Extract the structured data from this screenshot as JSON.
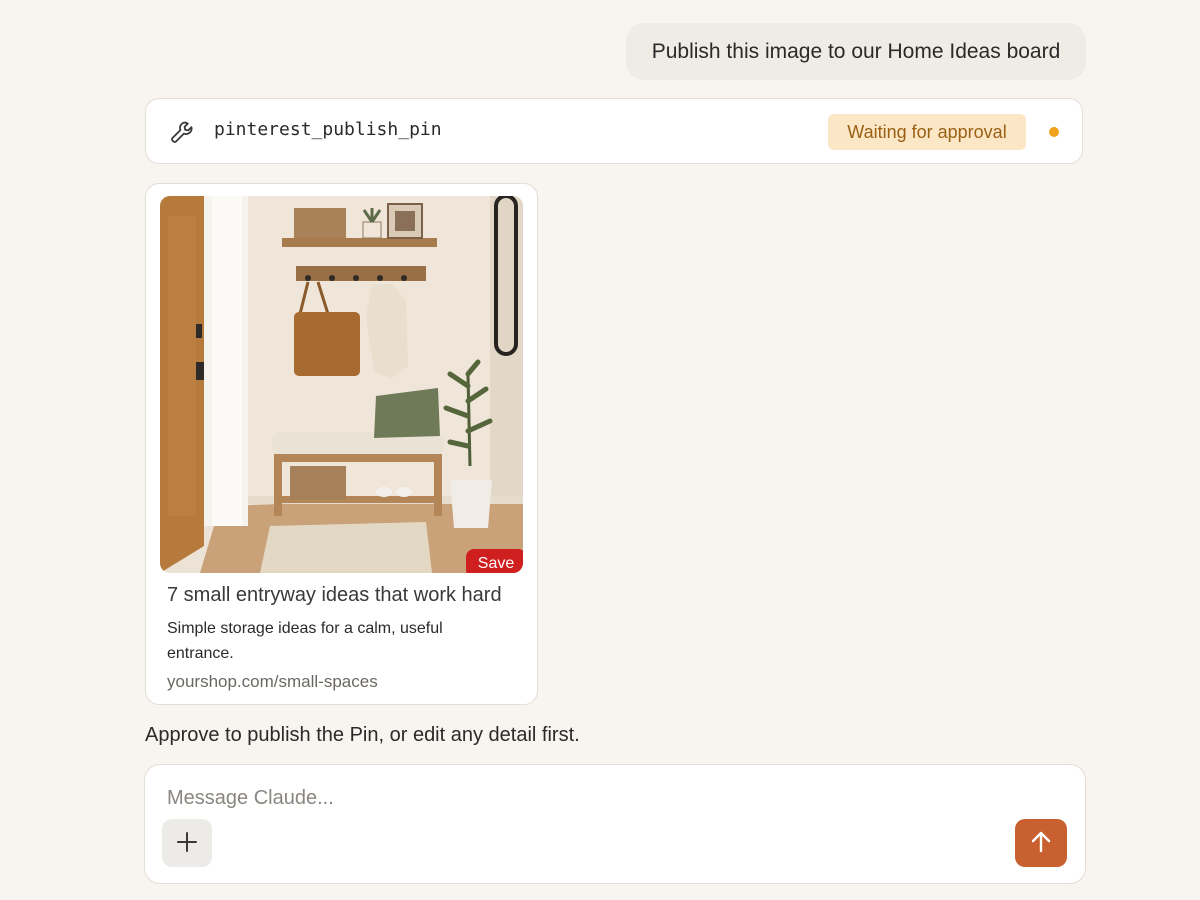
{
  "conversation": {
    "user_message": "Publish this image to our Home Ideas board",
    "assistant_message": "Approve to publish the Pin, or edit any detail first."
  },
  "tool_call": {
    "icon": "wrench-icon",
    "name": "pinterest_publish_pin",
    "status": "Waiting for approval",
    "status_color": "#f0a21b",
    "badge_bg": "#fbe6c6",
    "badge_text_color": "#9a6114"
  },
  "pin": {
    "save_label": "Save",
    "save_color": "#cf1f1f",
    "title": "7 small entryway ideas that work hard",
    "description": "Simple storage ideas for a calm, useful entrance.",
    "link": "yourshop.com/small-spaces"
  },
  "composer": {
    "placeholder": "Message Claude...",
    "attach_icon": "plus-icon",
    "send_icon": "arrow-up-icon",
    "send_color": "#c9602f"
  }
}
